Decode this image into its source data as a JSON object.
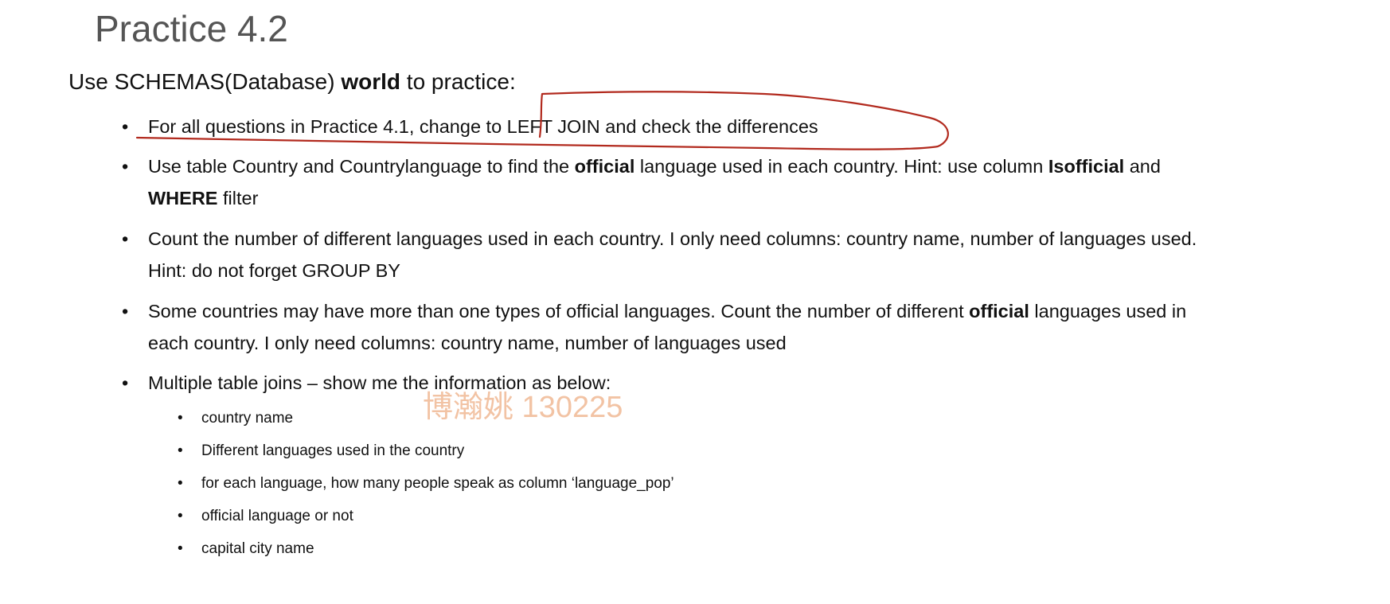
{
  "slide": {
    "title": "Practice 4.2",
    "intro": {
      "prefix": "Use SCHEMAS(Database) ",
      "bold": "world",
      "suffix": " to practice:"
    },
    "bullets": [
      {
        "text": "For all questions in Practice 4.1, change to LEFT JOIN and check the differences"
      },
      {
        "p1": "Use table Country and Countrylanguage to find the ",
        "b1": "official",
        "p2": " language used in each country. Hint: use column ",
        "b2": "Isofficial",
        "p3": " and",
        "b3": "WHERE",
        "p4": " filter"
      },
      {
        "line1": "Count the number of different languages used in each country. I only need columns: country name, number of languages used.",
        "line2": "Hint: do not forget GROUP BY"
      },
      {
        "p1": "Some countries may have more than one types of official languages. Count the number of different ",
        "b1": "official",
        "p2": " languages used in",
        "line2": "each country. I only need columns: country name, number of languages used"
      },
      {
        "text": "Multiple table joins – show me the information as below:",
        "subitems": [
          "country name",
          "Different languages used in the country",
          "for each language, how many people speak as column ‘language_pop’",
          "official language or not",
          "capital city name"
        ]
      }
    ],
    "watermark": "博瀚姚 130225"
  },
  "colors": {
    "title": "#555555",
    "text": "#111111",
    "annotation_stroke": "#b22a1e",
    "watermark": "#f2c3a4"
  }
}
